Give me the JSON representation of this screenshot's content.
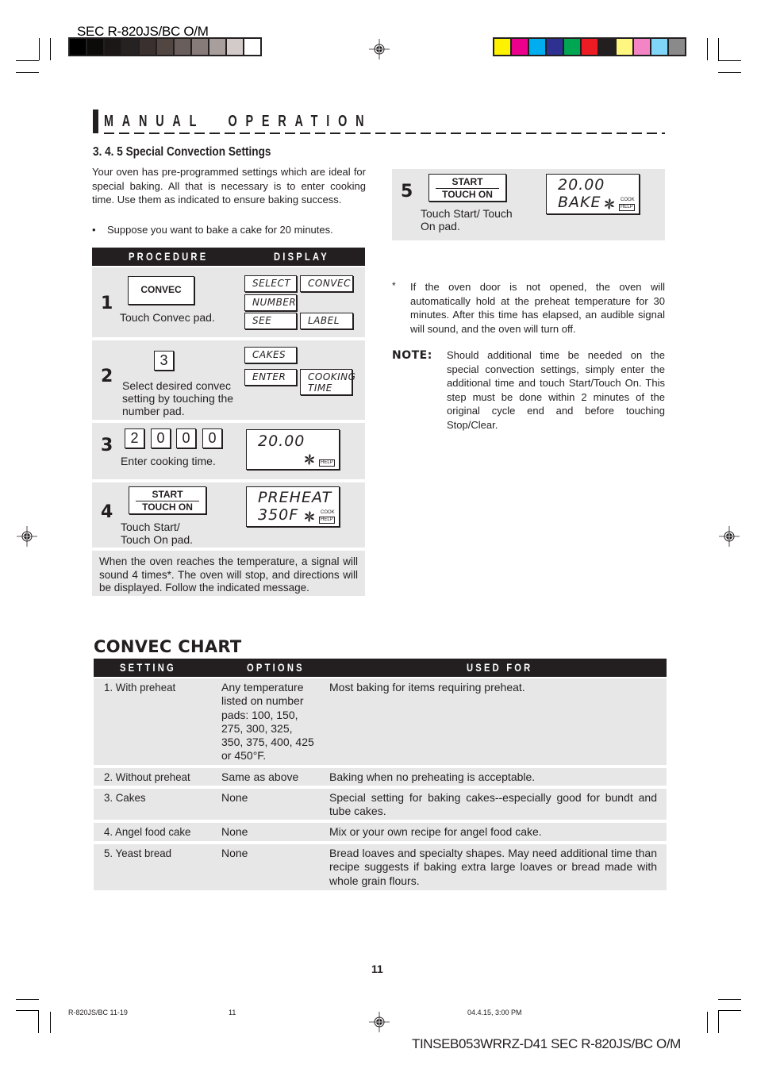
{
  "print_header": {
    "title": "SEC R-820JS/BC O/M",
    "grayscale_swatches": [
      "#000000",
      "#0d0b0a",
      "#1a1716",
      "#262221",
      "#3a302e",
      "#524643",
      "#6a5e5c",
      "#877b79",
      "#a89f9d",
      "#d3cbc9",
      "#ffffff"
    ],
    "color_swatches": [
      "#fff200",
      "#ec008c",
      "#00aeef",
      "#2e3192",
      "#00a651",
      "#ed1c24",
      "#231f20",
      "#fff67f",
      "#f384c6",
      "#7fd6f7",
      "#8a8a8a"
    ]
  },
  "section": {
    "title": "MANUAL  OPERATION",
    "subheading": "3. 4. 5  Special Convection Settings",
    "intro": "Your oven has  pre-programmed settings which are ideal for special baking. All that is necessary is to enter cooking time. Use them as indicated to ensure baking success.",
    "bullet": "Suppose you want to bake a cake for  20 minutes."
  },
  "procedure_table": {
    "header_procedure": "PROCEDURE",
    "header_display": "DISPLAY",
    "steps": [
      {
        "number": "1",
        "pad_label": "CONVEC",
        "instruction": "Touch Convec pad.",
        "display_words": [
          "SELECT",
          "CONVEC",
          "NUMBER",
          "SEE",
          "LABEL"
        ]
      },
      {
        "number": "2",
        "key": "3",
        "instruction": "Select desired convec setting by touching the number pad.",
        "display_words": [
          "CAKES",
          "ENTER",
          "COOKING",
          "TIME"
        ]
      },
      {
        "number": "3",
        "keys": [
          "2",
          "0",
          "0",
          "0"
        ],
        "instruction": "Enter cooking time.",
        "display_line1": "20.00",
        "display_help": "HELP"
      },
      {
        "number": "4",
        "pad_top": "START",
        "pad_bottom": "TOUCH ON",
        "instruction_line1": "Touch Start/",
        "instruction_line2": "Touch On pad.",
        "display_line1": "PREHEAT",
        "display_line2": "350F",
        "display_cook": "COOK",
        "display_help": "HELP"
      },
      {
        "number": "5",
        "pad_top": "START",
        "pad_bottom": "TOUCH ON",
        "instruction_line1": "Touch Start/ Touch",
        "instruction_line2": "On pad.",
        "display_line1": "20.00",
        "display_line2": "BAKE",
        "display_cook": "COOK",
        "display_help": "HELP"
      }
    ],
    "signal_note": "When the oven reaches the temperature, a signal will sound 4 times*. The oven will stop, and directions will be displayed. Follow the indicated message."
  },
  "footnote": {
    "marker": "*",
    "text": "If the oven door is not opened, the oven will automatically hold at the preheat temperature for 30 minutes. After this time has elapsed, an audible signal will sound, and the oven will turn off."
  },
  "note": {
    "label": "NOTE:",
    "text": "Should additional time be needed on the special convection settings, simply enter the additional time and touch Start/Touch On. This step must be done within 2 minutes of the original cycle end and before touching Stop/Clear."
  },
  "convec_chart": {
    "title": "CONVEC CHART",
    "headers": [
      "SETTING",
      "OPTIONS",
      "USED FOR"
    ],
    "rows": [
      {
        "setting": "1. With preheat",
        "options": "Any temperature listed on number pads: 100, 150, 275, 300, 325, 350, 375, 400, 425 or 450°F.",
        "used_for": "Most baking for items requiring preheat."
      },
      {
        "setting": "2. Without preheat",
        "options": "Same as above",
        "used_for": "Baking when no preheating is acceptable."
      },
      {
        "setting": "3. Cakes",
        "options": "None",
        "used_for": "Special setting for baking cakes--especially good for bundt and tube cakes."
      },
      {
        "setting": "4. Angel food cake",
        "options": "None",
        "used_for": "Mix or your own recipe for angel food cake."
      },
      {
        "setting": "5. Yeast bread",
        "options": "None",
        "used_for": "Bread loaves and specialty shapes. May need additional time than recipe suggests if baking extra large loaves or bread made with whole grain flours."
      }
    ]
  },
  "page_number": "11",
  "print_footer": {
    "file_ref": "R-820JS/BC 11-19",
    "page": "11",
    "timestamp": "04.4.15, 3:00 PM",
    "doc_code": "TINSEB053WRRZ-D41 SEC R-820JS/BC O/M"
  }
}
